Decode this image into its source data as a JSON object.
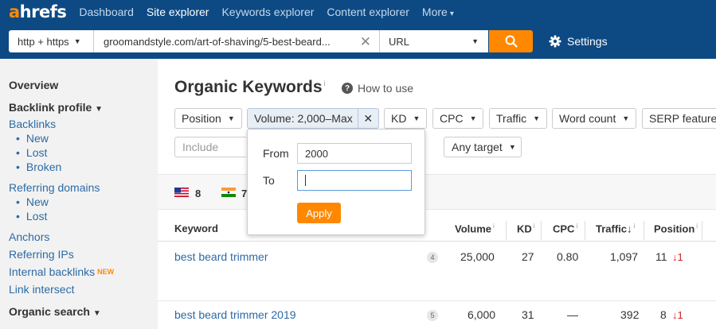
{
  "nav": {
    "logo_a": "a",
    "logo_rest": "hrefs",
    "items": [
      "Dashboard",
      "Site explorer",
      "Keywords explorer",
      "Content explorer",
      "More"
    ],
    "more_caret": "▾"
  },
  "search": {
    "protocol": "http + https",
    "url": "groomandstyle.com/art-of-shaving/5-best-beard...",
    "mode": "URL",
    "settings_label": "Settings"
  },
  "sidebar": {
    "overview": "Overview",
    "backlink_profile": "Backlink profile",
    "backlinks": "Backlinks",
    "backlinks_sub": [
      "New",
      "Lost",
      "Broken"
    ],
    "referring_domains": "Referring domains",
    "referring_sub": [
      "New",
      "Lost"
    ],
    "anchors": "Anchors",
    "referring_ips": "Referring IPs",
    "internal_backlinks": "Internal backlinks",
    "new_badge": "NEW",
    "link_intersect": "Link intersect",
    "organic_search": "Organic search"
  },
  "main": {
    "title": "Organic Keywords",
    "title_info": "i",
    "how_to_use": "How to use",
    "filters": {
      "position": "Position",
      "volume": "Volume: 2,000–Max",
      "kd": "KD",
      "cpc": "CPC",
      "traffic": "Traffic",
      "word_count": "Word count",
      "serp_features": "SERP features"
    },
    "include_placeholder": "Include",
    "any_target": "Any target",
    "countries": [
      {
        "flag": "us",
        "count": "8"
      },
      {
        "flag": "in",
        "count": "7"
      }
    ]
  },
  "popup": {
    "from_label": "From",
    "from_value": "2000",
    "to_label": "To",
    "to_value": "",
    "apply_label": "Apply"
  },
  "table": {
    "headers": {
      "keyword": "Keyword",
      "volume": "Volume",
      "kd": "KD",
      "cpc": "CPC",
      "traffic": "Traffic",
      "traffic_sort": "↓",
      "position": "Position",
      "info": "i"
    },
    "rows": [
      {
        "keyword": "best beard trimmer",
        "serp": "4",
        "volume": "25,000",
        "kd": "27",
        "cpc": "0.80",
        "traffic": "1,097",
        "position": "11",
        "change": "↓1"
      },
      {
        "keyword": "best beard trimmer 2019",
        "serp": "5",
        "volume": "6,000",
        "kd": "31",
        "cpc": "—",
        "traffic": "392",
        "position": "8",
        "change": "↓1"
      }
    ]
  },
  "colors": {
    "nav_bg": "#0d4a84",
    "accent": "#ff8800",
    "link": "#2c6aa6",
    "down": "#cc2222"
  }
}
